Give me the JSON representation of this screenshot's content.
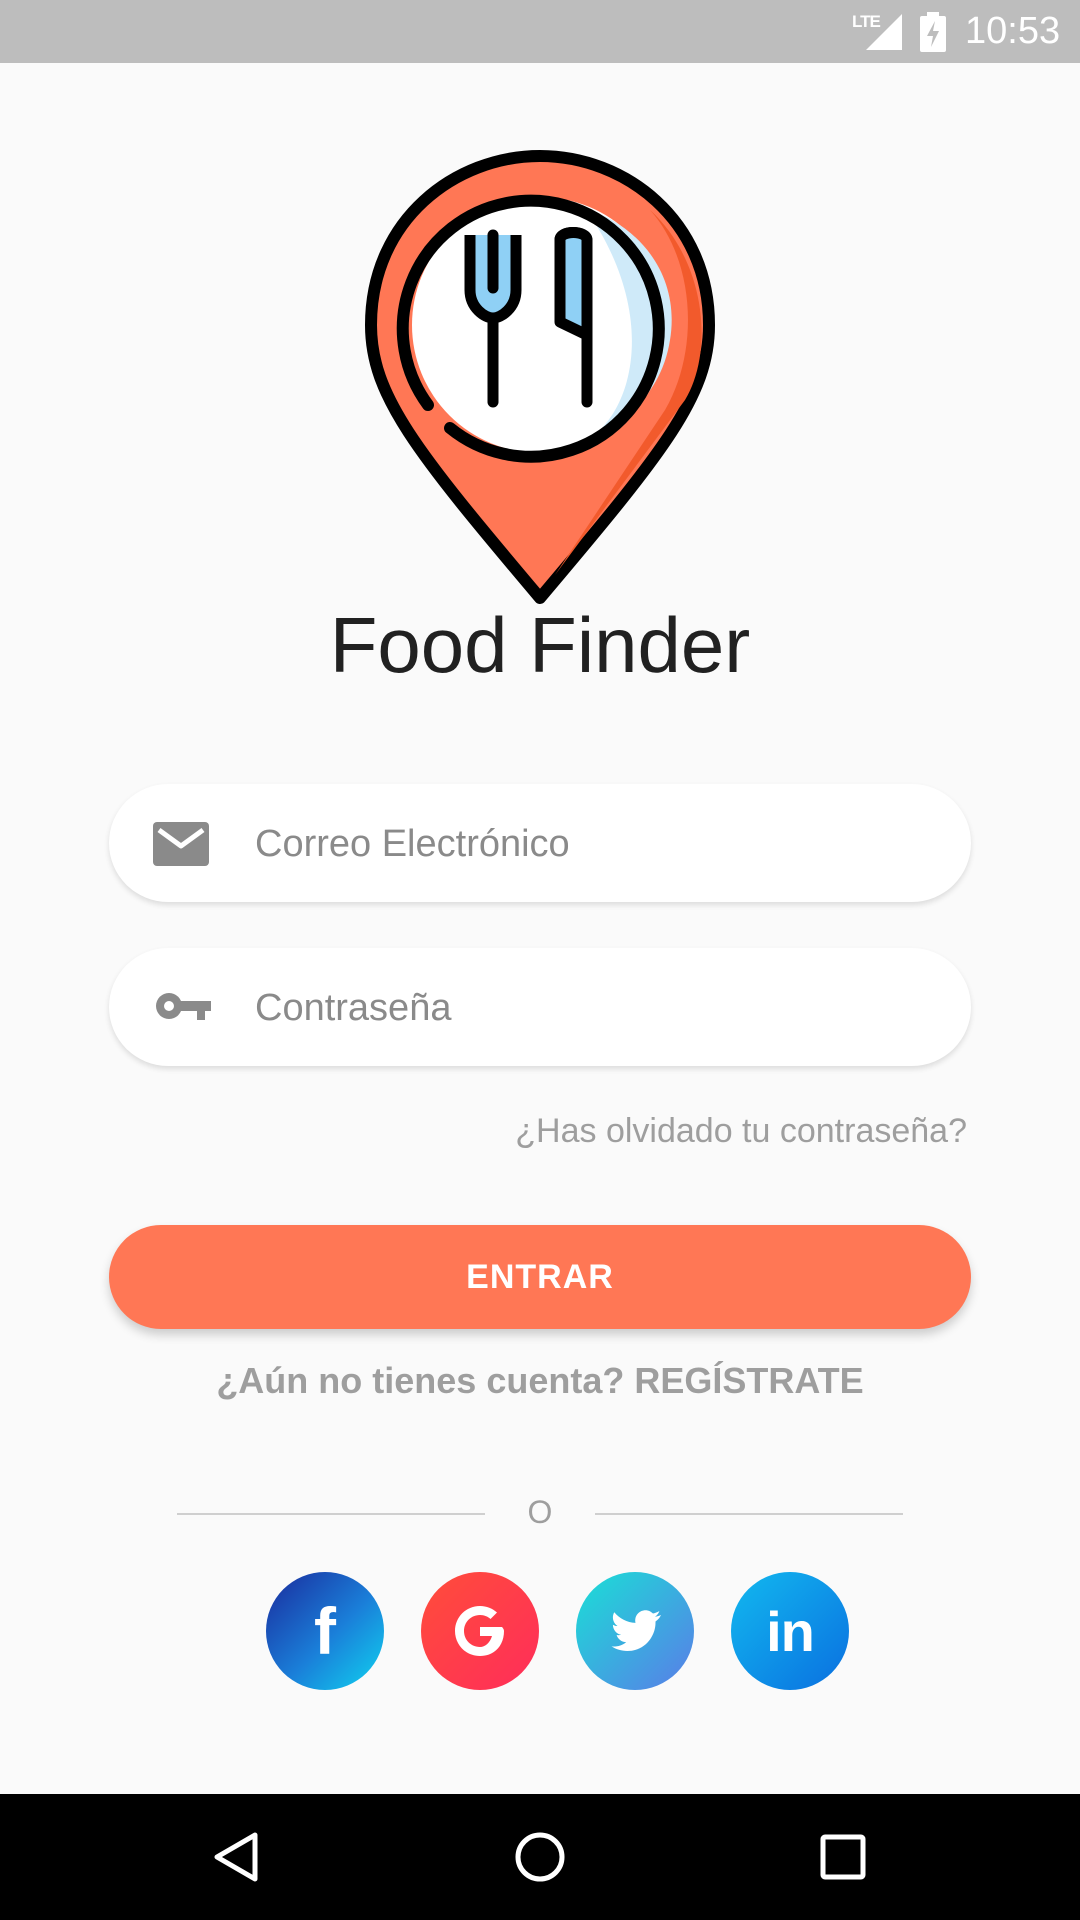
{
  "status_bar": {
    "network": "LTE",
    "time": "10:53"
  },
  "app": {
    "title": "Food Finder"
  },
  "form": {
    "email_placeholder": "Correo Electrónico",
    "password_placeholder": "Contraseña",
    "forgot_password": "¿Has olvidado tu contraseña?",
    "login_button": "ENTRAR",
    "register_prompt": "¿Aún no tienes cuenta? REGÍSTRATE"
  },
  "divider": {
    "label": "O"
  },
  "social": [
    {
      "name": "facebook-icon",
      "glyph": "f"
    },
    {
      "name": "google-icon",
      "glyph": "G"
    },
    {
      "name": "twitter-icon",
      "glyph": ""
    },
    {
      "name": "linkedin-icon",
      "glyph": "in"
    }
  ],
  "colors": {
    "accent": "#ff7755",
    "background": "#fafafa",
    "status_bar": "#bdbdbd",
    "muted_text": "#9e9e9e"
  }
}
